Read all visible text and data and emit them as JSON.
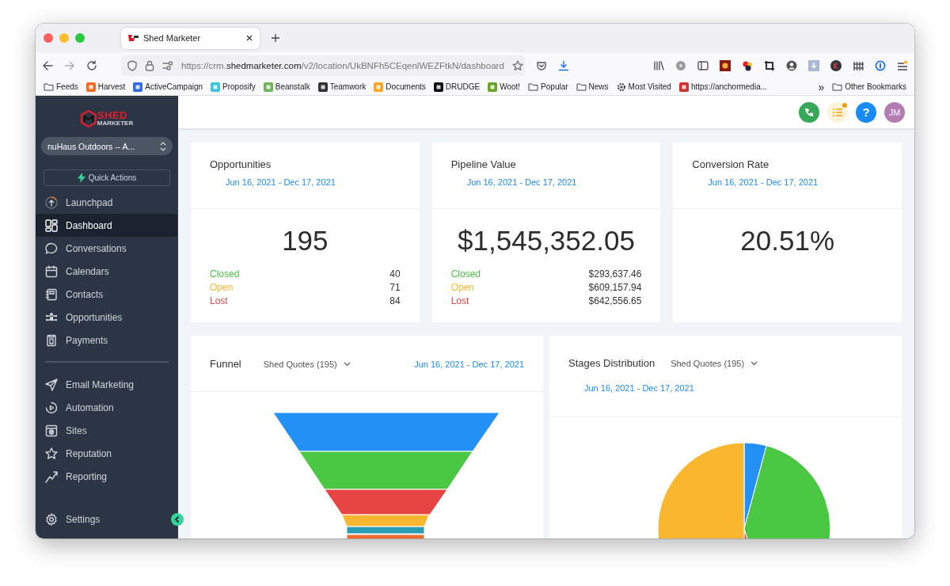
{
  "browser": {
    "tab_title": "Shed Marketer",
    "url_prefix": "https://crm.",
    "url_host": "shedmarketer.com",
    "url_path": "/v2/location/UkBNFh5CEqenlWEZFtkN/dashboard",
    "bookmarks": [
      {
        "label": "Feeds",
        "kind": "folder"
      },
      {
        "label": "Harvest",
        "kind": "site",
        "color": "#f36c21"
      },
      {
        "label": "ActiveCampaign",
        "kind": "site",
        "color": "#356ae6"
      },
      {
        "label": "Proposify",
        "kind": "site",
        "color": "#3fc1e0"
      },
      {
        "label": "Beanstalk",
        "kind": "site",
        "color": "#6fb55c"
      },
      {
        "label": "Teamwork",
        "kind": "site",
        "color": "#333333"
      },
      {
        "label": "Documents",
        "kind": "site",
        "color": "#f5a623"
      },
      {
        "label": "DRUDGE",
        "kind": "site",
        "color": "#111111"
      },
      {
        "label": "Woot!",
        "kind": "site",
        "color": "#6aa329"
      },
      {
        "label": "Popular",
        "kind": "folder"
      },
      {
        "label": "News",
        "kind": "folder"
      },
      {
        "label": "Most Visited",
        "kind": "gear"
      },
      {
        "label": "https://anchormedia...",
        "kind": "site",
        "color": "#d0322f"
      }
    ],
    "overflow": "»",
    "other_bookmarks": "Other Bookmarks"
  },
  "sidebar": {
    "logo_top": "SHED",
    "logo_bottom": "MARKETER",
    "location": "nuHaus Outdoors -- A...",
    "quick_actions": "Quick Actions",
    "items": [
      {
        "label": "Launchpad",
        "selected": false
      },
      {
        "label": "Dashboard",
        "selected": true
      },
      {
        "label": "Conversations",
        "selected": false
      },
      {
        "label": "Calendars",
        "selected": false
      },
      {
        "label": "Contacts",
        "selected": false
      },
      {
        "label": "Opportunities",
        "selected": false
      },
      {
        "label": "Payments",
        "selected": false
      }
    ],
    "items_2": [
      {
        "label": "Email Marketing",
        "selected": false
      },
      {
        "label": "Automation",
        "selected": false
      },
      {
        "label": "Sites",
        "selected": false
      },
      {
        "label": "Reputation",
        "selected": false
      },
      {
        "label": "Reporting",
        "selected": false
      }
    ],
    "settings": "Settings"
  },
  "header": {
    "help": "?",
    "avatar": "JM"
  },
  "cards": [
    {
      "title": "Opportunities",
      "date": "Jun 16, 2021 - Dec 17, 2021",
      "value": "195",
      "rows": [
        {
          "label": "Closed",
          "value": "40",
          "color": "#4bc443"
        },
        {
          "label": "Open",
          "value": "71",
          "color": "#fbb62f"
        },
        {
          "label": "Lost",
          "value": "84",
          "color": "#e74646"
        }
      ]
    },
    {
      "title": "Pipeline Value",
      "date": "Jun 16, 2021 - Dec 17, 2021",
      "value": "$1,545,352.05",
      "rows": [
        {
          "label": "Closed",
          "value": "$293,637.46",
          "color": "#4bc443"
        },
        {
          "label": "Open",
          "value": "$609,157.94",
          "color": "#fbb62f"
        },
        {
          "label": "Lost",
          "value": "$642,556.65",
          "color": "#e74646"
        }
      ]
    },
    {
      "title": "Conversion Rate",
      "date": "Jun 16, 2021 - Dec 17, 2021",
      "value": "20.51%"
    }
  ],
  "panels": [
    {
      "kind": "funnel",
      "title": "Funnel",
      "dropdown": "Shed Quotes (195)",
      "date": "Jun 16, 2021 - Dec 17, 2021"
    },
    {
      "kind": "pie",
      "title": "Stages Distribution",
      "dropdown": "Shed Quotes (195)",
      "date": "Jun 16, 2021 - Dec 17, 2021"
    }
  ]
}
